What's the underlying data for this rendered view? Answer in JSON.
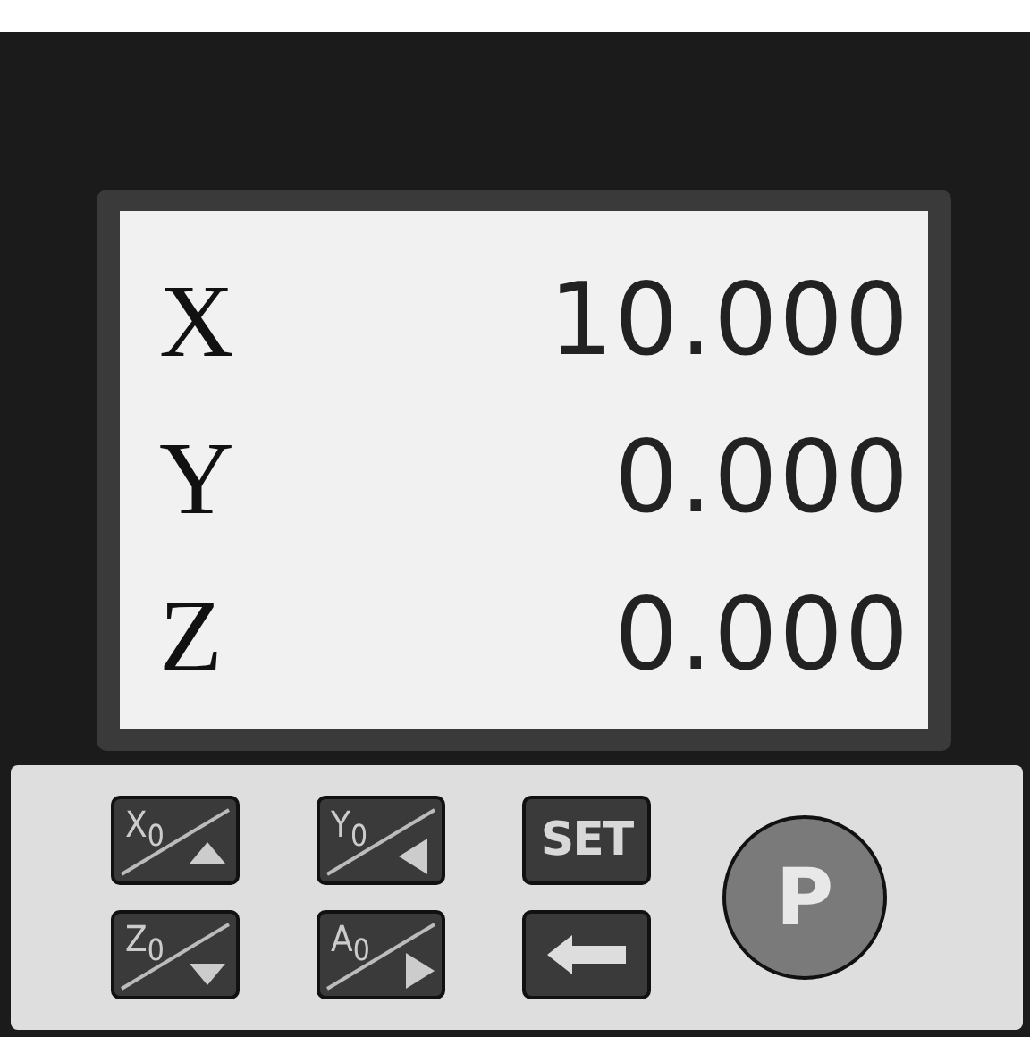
{
  "display": {
    "rows": [
      {
        "axis": "X",
        "value": "10.000"
      },
      {
        "axis": "Y",
        "value": "0.000"
      },
      {
        "axis": "Z",
        "value": "0.000"
      }
    ]
  },
  "keypad": {
    "keys": [
      {
        "kind": "up",
        "label": "X$_{0}$"
      },
      {
        "kind": "left",
        "label": "Y$_{0}$"
      },
      {
        "kind": "text",
        "label": "SET"
      },
      {
        "kind": "down",
        "label": "Z$_{0}$"
      },
      {
        "kind": "right",
        "label": "A$_{0}$"
      },
      {
        "kind": "back"
      }
    ],
    "round_key": {
      "label": "P"
    }
  }
}
